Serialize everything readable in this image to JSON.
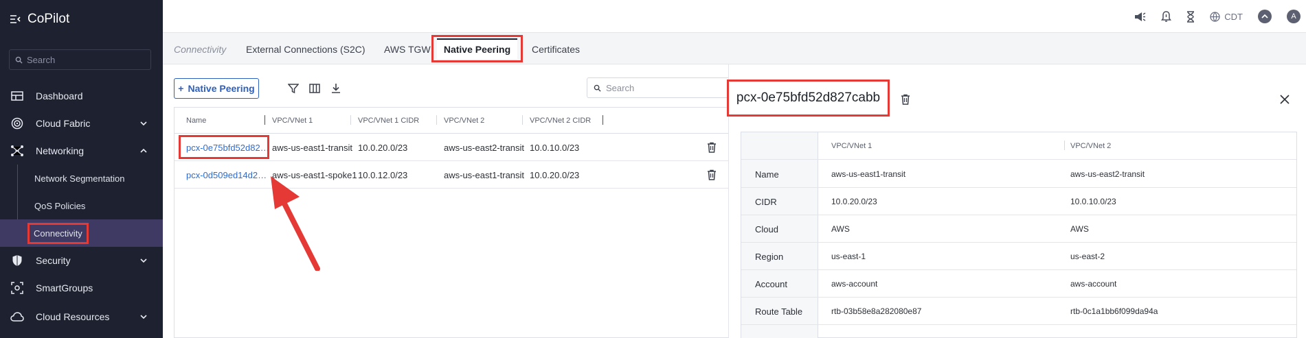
{
  "app": {
    "title": "CoPilot"
  },
  "sidebar": {
    "search_placeholder": "Search",
    "items": [
      {
        "label": "Dashboard"
      },
      {
        "label": "Cloud Fabric"
      },
      {
        "label": "Networking"
      },
      {
        "label": "Network Segmentation"
      },
      {
        "label": "QoS Policies"
      },
      {
        "label": "Connectivity"
      },
      {
        "label": "Security"
      },
      {
        "label": "SmartGroups"
      },
      {
        "label": "Cloud Resources"
      }
    ]
  },
  "topbar": {
    "timezone": "CDT",
    "avatar_initial": "A"
  },
  "tabs": [
    {
      "label": "Connectivity"
    },
    {
      "label": "External Connections (S2C)"
    },
    {
      "label": "AWS TGW"
    },
    {
      "label": "Native Peering"
    },
    {
      "label": "Certificates"
    }
  ],
  "toolbar": {
    "add_label": "Native Peering",
    "search_placeholder": "Search"
  },
  "table": {
    "headers": [
      "Name",
      "VPC/VNet 1",
      "VPC/VNet 1 CIDR",
      "VPC/VNet 2",
      "VPC/VNet 2 CIDR"
    ],
    "rows": [
      {
        "name": "pcx-0e75bfd52d82…",
        "vnet1": "aws-us-east1-transit",
        "cidr1": "10.0.20.0/23",
        "vnet2": "aws-us-east2-transit",
        "cidr2": "10.0.10.0/23"
      },
      {
        "name": "pcx-0d509ed14d2…",
        "vnet1": "aws-us-east1-spoke1",
        "cidr1": "10.0.12.0/23",
        "vnet2": "aws-us-east1-transit",
        "cidr2": "10.0.20.0/23"
      }
    ]
  },
  "detail": {
    "title": "pcx-0e75bfd52d827cabb",
    "col1": "VPC/VNet 1",
    "col2": "VPC/VNet 2",
    "rows": [
      {
        "label": "Name",
        "v1": "aws-us-east1-transit",
        "v2": "aws-us-east2-transit"
      },
      {
        "label": "CIDR",
        "v1": "10.0.20.0/23",
        "v2": "10.0.10.0/23"
      },
      {
        "label": "Cloud",
        "v1": "AWS",
        "v2": "AWS"
      },
      {
        "label": "Region",
        "v1": "us-east-1",
        "v2": "us-east-2"
      },
      {
        "label": "Account",
        "v1": "aws-account",
        "v2": "aws-account"
      },
      {
        "label": "Route Table",
        "v1": "rtb-03b58e8a282080e87",
        "v2": "rtb-0c1a1bb6f099da94a"
      }
    ]
  },
  "colors": {
    "sidebar_bg": "#1e2130",
    "accent": "#2d5fbf",
    "highlight": "#e53935"
  }
}
